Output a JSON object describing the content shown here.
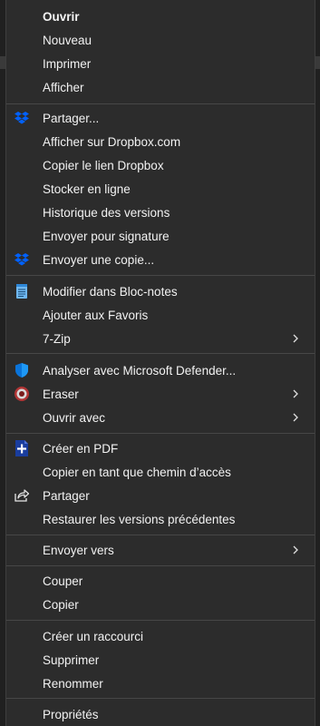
{
  "menu": {
    "items": [
      {
        "label": "Ouvrir",
        "icon": null,
        "submenu": false,
        "bold": true
      },
      {
        "label": "Nouveau",
        "icon": null,
        "submenu": false
      },
      {
        "label": "Imprimer",
        "icon": null,
        "submenu": false
      },
      {
        "label": "Afficher",
        "icon": null,
        "submenu": false
      },
      {
        "label": "Partager...",
        "icon": "dropbox-icon",
        "submenu": false
      },
      {
        "label": "Afficher sur Dropbox.com",
        "icon": null,
        "submenu": false
      },
      {
        "label": "Copier le lien Dropbox",
        "icon": null,
        "submenu": false
      },
      {
        "label": "Stocker en ligne",
        "icon": null,
        "submenu": false
      },
      {
        "label": "Historique des versions",
        "icon": null,
        "submenu": false
      },
      {
        "label": "Envoyer pour signature",
        "icon": null,
        "submenu": false
      },
      {
        "label": "Envoyer une copie...",
        "icon": "dropbox-icon",
        "submenu": false
      },
      {
        "label": "Modifier dans Bloc-notes",
        "icon": "notepad-icon",
        "submenu": false
      },
      {
        "label": "Ajouter aux Favoris",
        "icon": null,
        "submenu": false
      },
      {
        "label": "7-Zip",
        "icon": null,
        "submenu": true
      },
      {
        "label": "Analyser avec Microsoft Defender...",
        "icon": "defender-shield-icon",
        "submenu": false
      },
      {
        "label": "Eraser",
        "icon": "eraser-icon",
        "submenu": true
      },
      {
        "label": "Ouvrir avec",
        "icon": null,
        "submenu": true
      },
      {
        "label": "Créer en PDF",
        "icon": "create-pdf-icon",
        "submenu": false
      },
      {
        "label": "Copier en tant que chemin d’accès",
        "icon": null,
        "submenu": false
      },
      {
        "label": "Partager",
        "icon": "share-icon",
        "submenu": false
      },
      {
        "label": "Restaurer les versions précédentes",
        "icon": null,
        "submenu": false
      },
      {
        "label": "Envoyer vers",
        "icon": null,
        "submenu": true
      },
      {
        "label": "Couper",
        "icon": null,
        "submenu": false
      },
      {
        "label": "Copier",
        "icon": null,
        "submenu": false
      },
      {
        "label": "Créer un raccourci",
        "icon": null,
        "submenu": false
      },
      {
        "label": "Supprimer",
        "icon": null,
        "submenu": false
      },
      {
        "label": "Renommer",
        "icon": null,
        "submenu": false
      },
      {
        "label": "Propriétés",
        "icon": null,
        "submenu": false
      }
    ]
  },
  "colors": {
    "menu_bg": "#2c2c2c",
    "text": "#f2f2f2",
    "separator": "#474747",
    "dropbox_blue": "#0061fe",
    "defender_blue": "#0a74da"
  }
}
